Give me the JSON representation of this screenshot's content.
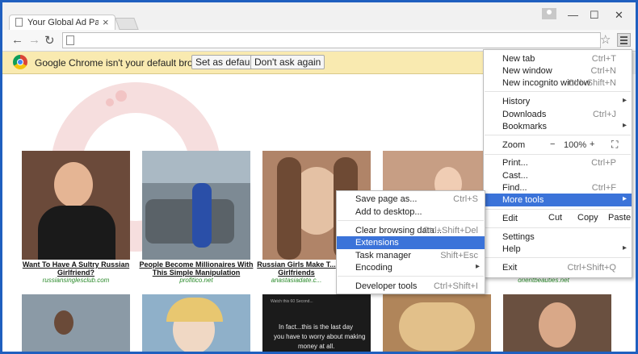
{
  "tab": {
    "title": "Your Global Ad Partner - V",
    "close": "×"
  },
  "window": {
    "minimize": "—",
    "maximize": "☐",
    "close": "✕"
  },
  "toolbar": {
    "back": "←",
    "forward": "→",
    "reload": "↻",
    "url": "",
    "star": "☆"
  },
  "infobar": {
    "message": "Google Chrome isn't your default browser.",
    "set_default": "Set as default",
    "dont_ask": "Don't ask again"
  },
  "thumbnails": [
    {
      "caption": "Want To Have A Sultry Russian Girlfriend?",
      "domain": "russiansinglesclub.com",
      "color": "#6b4a3a"
    },
    {
      "caption": "People Become Millionaires With This Simple Manipulation",
      "domain": "profitico.net",
      "color": "#7d8a94"
    },
    {
      "caption": "Russian Girls Make T... Girlfriends",
      "domain": "anastasiadate.c...",
      "color": "#b08468"
    },
    {
      "caption": "",
      "domain": "orientbeauties.net",
      "color": "#c79e84"
    }
  ],
  "bottom_thumbs": [
    {
      "color": "#8b9aa6"
    },
    {
      "color": "#8fb0c9"
    },
    {
      "color": "#1b1b1b",
      "text1": "In fact...this is the last day",
      "text2": "you have to worry about making",
      "text3": "money at all.",
      "top": "Watch this 60 Second..."
    },
    {
      "color": "#b0855a"
    },
    {
      "color": "#6a5040"
    }
  ],
  "menu": {
    "new_tab": {
      "label": "New tab",
      "shortcut": "Ctrl+T"
    },
    "new_window": {
      "label": "New window",
      "shortcut": "Ctrl+N"
    },
    "new_incognito": {
      "label": "New incognito window",
      "shortcut": "Ctrl+Shift+N"
    },
    "history": {
      "label": "History",
      "arrow": "▸"
    },
    "downloads": {
      "label": "Downloads",
      "shortcut": "Ctrl+J"
    },
    "bookmarks": {
      "label": "Bookmarks",
      "arrow": "▸"
    },
    "zoom": {
      "label": "Zoom",
      "minus": "−",
      "value": "100%",
      "plus": "+",
      "fullscreen": "⛶"
    },
    "print": {
      "label": "Print...",
      "shortcut": "Ctrl+P"
    },
    "cast": {
      "label": "Cast..."
    },
    "find": {
      "label": "Find...",
      "shortcut": "Ctrl+F"
    },
    "more_tools": {
      "label": "More tools",
      "arrow": "▸"
    },
    "edit": {
      "label": "Edit",
      "cut": "Cut",
      "copy": "Copy",
      "paste": "Paste"
    },
    "settings": {
      "label": "Settings"
    },
    "help": {
      "label": "Help",
      "arrow": "▸"
    },
    "exit": {
      "label": "Exit",
      "shortcut": "Ctrl+Shift+Q"
    }
  },
  "submenu": {
    "save_page": {
      "label": "Save page as...",
      "shortcut": "Ctrl+S"
    },
    "add_desktop": {
      "label": "Add to desktop..."
    },
    "clear_data": {
      "label": "Clear browsing data...",
      "shortcut": "Ctrl+Shift+Del"
    },
    "extensions": {
      "label": "Extensions"
    },
    "task_manager": {
      "label": "Task manager",
      "shortcut": "Shift+Esc"
    },
    "encoding": {
      "label": "Encoding",
      "arrow": "▸"
    },
    "dev_tools": {
      "label": "Developer tools",
      "shortcut": "Ctrl+Shift+I"
    }
  },
  "colors": {
    "accent": "#3b73d9",
    "infobar": "#f9eab0",
    "frame": "#1f5fbf",
    "link_green": "#2a8a2a"
  }
}
